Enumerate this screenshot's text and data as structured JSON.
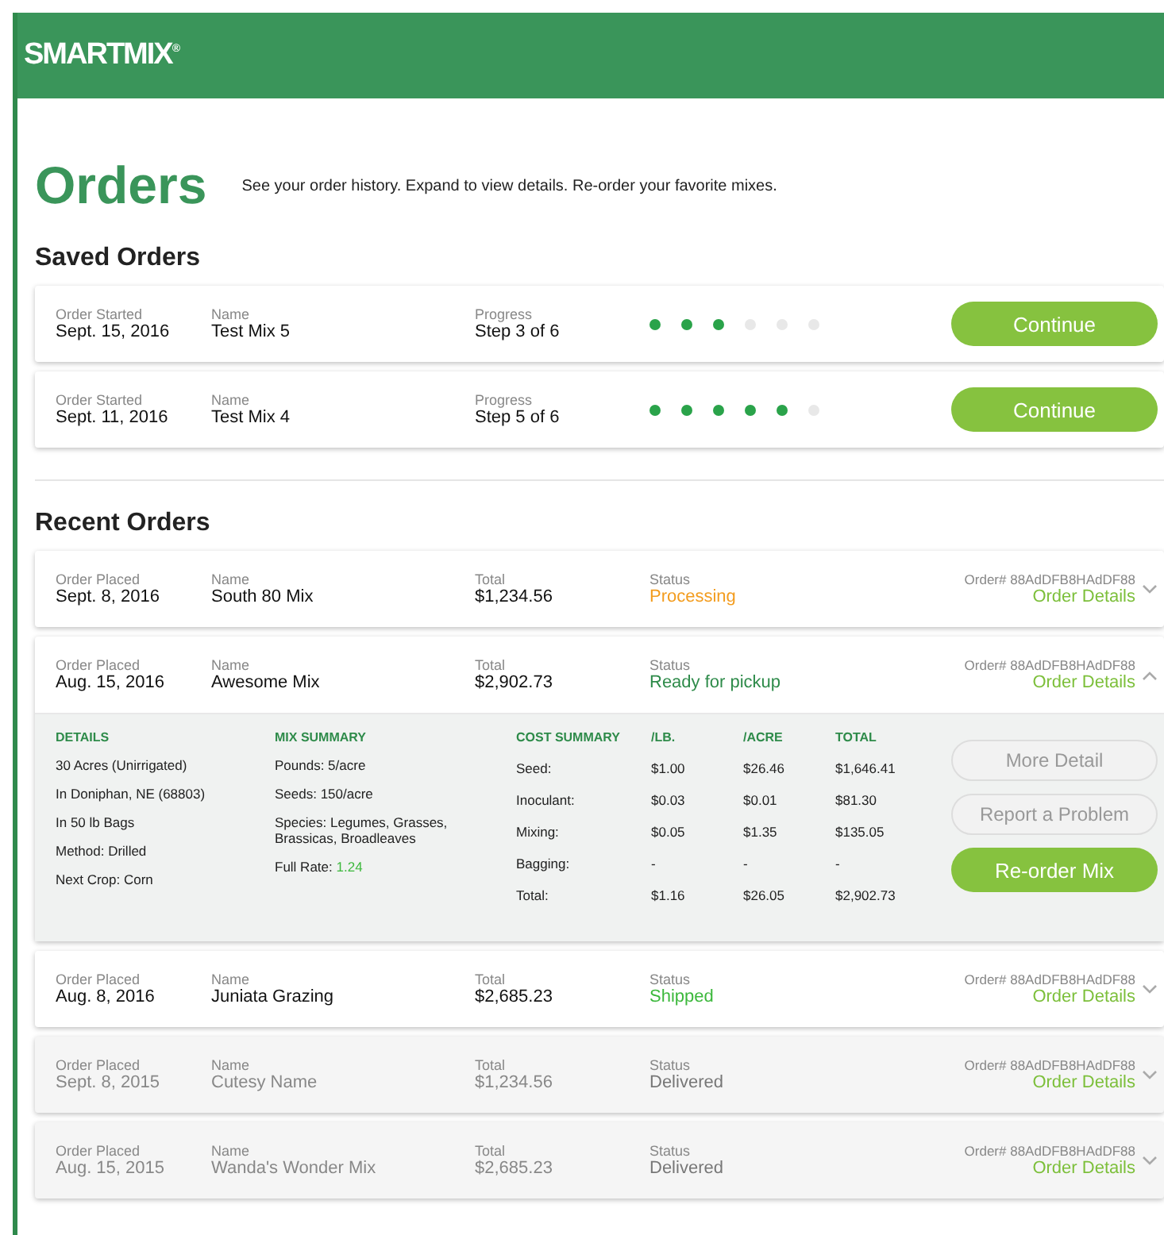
{
  "header": {
    "logo": "SMARTMIX",
    "logo_mark": "®"
  },
  "title": "Orders",
  "subtitle": "See your order history. Expand to view details. Re-order your favorite mixes.",
  "saved_orders": {
    "heading": "Saved Orders",
    "orders": [
      {
        "date_label": "Order Started",
        "date": "Sept. 15, 2016",
        "name_label": "Name",
        "name": "Test Mix 5",
        "progress_label": "Progress",
        "progress": "Step 3 of 6",
        "level": 0.5,
        "button": "Continue"
      },
      {
        "date_label": "Order Started",
        "date": "Sept. 11, 2016",
        "name_label": "Name",
        "name": "Test Mix 4",
        "progress_label": "Progress",
        "progress": "Step 5 of 6",
        "level": 0.8333,
        "button": "Continue"
      }
    ]
  },
  "recent_orders": {
    "heading": "Recent Orders",
    "orders": [
      {
        "date_label": "Order Placed",
        "date": "Sept. 8, 2016",
        "name_label": "Name",
        "name": "South 80 Mix",
        "total_label": "Total",
        "total": "$1,234.56",
        "status_label": "Status",
        "status": "Processing",
        "kind": "processing",
        "order_number": "Order# 88AdDFB8HAdDF88",
        "details_link": "Order Details",
        "expanded": false
      },
      {
        "date_label": "Order Placed",
        "date": "Aug. 15, 2016",
        "name_label": "Name",
        "name": "Awesome Mix",
        "total_label": "Total",
        "total": "$2,902.73",
        "status_label": "Status",
        "status": "Ready for pickup",
        "kind": "ready",
        "order_number": "Order# 88AdDFB8HAdDF88",
        "details_link": "Order Details",
        "expanded": true,
        "details": {
          "details_heading": "DETAILS",
          "details_lines": [
            "30 Acres (Unirrigated)",
            "In Doniphan, NE (68803)",
            "In 50 lb Bags",
            "Method: Drilled",
            "Next Crop: Corn"
          ],
          "mix_heading": "MIX SUMMARY",
          "mix_lines": [
            "Pounds: 5/acre",
            "Seeds: 150/acre",
            "Species: Legumes, Grasses, Brassicas, Broadleaves"
          ],
          "full_rate_label": "Full Rate:",
          "full_rate": "1.24",
          "cost_columns": [
            "COST SUMMARY",
            "/LB.",
            "/ACRE",
            "TOTAL"
          ],
          "cost_rows": [
            [
              "Seed:",
              "$1.00",
              "$26.46",
              "$1,646.41"
            ],
            [
              "Inoculant:",
              "$0.03",
              "$0.01",
              "$81.30"
            ],
            [
              "Mixing:",
              "$0.05",
              "$1.35",
              "$135.05"
            ],
            [
              "Bagging:",
              "-",
              "-",
              "-"
            ],
            [
              "Total:",
              "$1.16",
              "$26.05",
              "$2,902.73"
            ]
          ],
          "buttons": [
            {
              "label": "More Detail",
              "kind": "secondary"
            },
            {
              "label": "Report a Problem",
              "kind": "secondary"
            },
            {
              "label": "Re-order Mix",
              "kind": "primary"
            }
          ]
        }
      },
      {
        "date_label": "Order Placed",
        "date": "Aug. 8, 2016",
        "name_label": "Name",
        "name": "Juniata Grazing",
        "total_label": "Total",
        "total": "$2,685.23",
        "status_label": "Status",
        "status": "Shipped",
        "kind": "shipped",
        "order_number": "Order# 88AdDFB8HAdDF88",
        "details_link": "Order Details",
        "expanded": false
      },
      {
        "date_label": "Order Placed",
        "date": "Sept. 8, 2015",
        "name_label": "Name",
        "name": "Cutesy Name",
        "total_label": "Total",
        "total": "$1,234.56",
        "status_label": "Status",
        "status": "Delivered",
        "kind": "delivered",
        "order_number": "Order# 88AdDFB8HAdDF88",
        "details_link": "Order Details",
        "expanded": false
      },
      {
        "date_label": "Order Placed",
        "date": "Aug. 15, 2015",
        "name_label": "Name",
        "name": "Wanda's Wonder Mix",
        "total_label": "Total",
        "total": "$2,685.23",
        "status_label": "Status",
        "status": "Delivered",
        "kind": "delivered",
        "order_number": "Order# 88AdDFB8HAdDF88",
        "details_link": "Order Details",
        "expanded": false
      }
    ]
  }
}
